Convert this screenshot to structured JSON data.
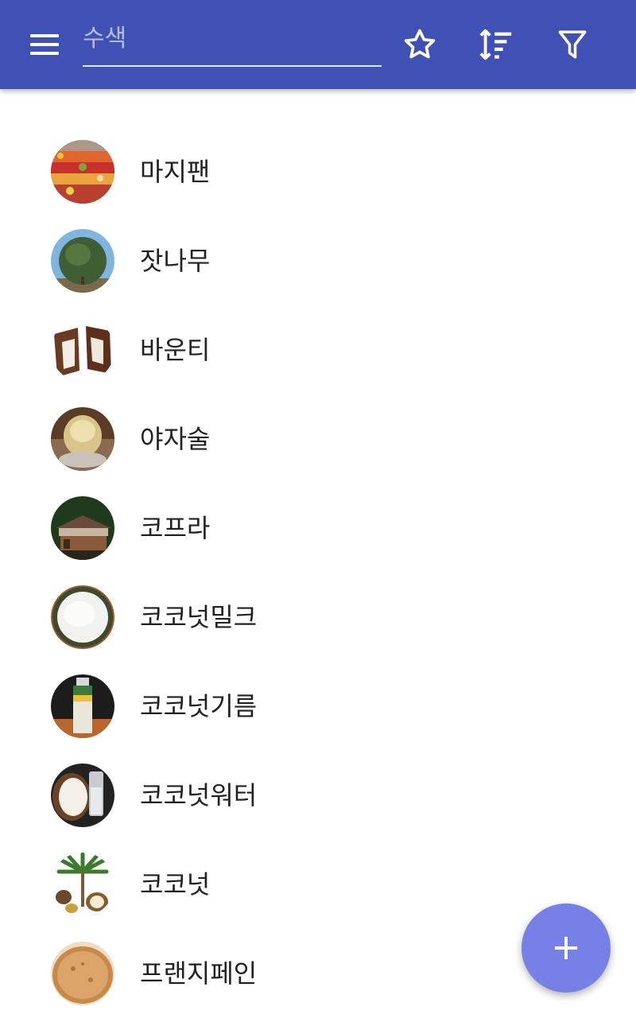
{
  "header": {
    "search_placeholder": "수색",
    "search_value": "",
    "icons": {
      "menu": "menu-icon",
      "favorite": "star-outline-icon",
      "sort": "sort-icon",
      "filter": "filter-icon"
    },
    "background_color": "#3f51b5"
  },
  "items": [
    {
      "label": "마지팬",
      "thumb": "fruit-market-photo"
    },
    {
      "label": "잣나무",
      "thumb": "pine-tree-photo"
    },
    {
      "label": "바운티",
      "thumb": "chocolate-bar-photo"
    },
    {
      "label": "야자술",
      "thumb": "glass-drink-photo"
    },
    {
      "label": "코프라",
      "thumb": "drying-house-photo"
    },
    {
      "label": "코코넛밀크",
      "thumb": "milk-bowl-photo"
    },
    {
      "label": "코코넛기름",
      "thumb": "oil-bottle-photo"
    },
    {
      "label": "코코넛워터",
      "thumb": "coconut-water-photo"
    },
    {
      "label": "코코넛",
      "thumb": "coconut-palm-illustration"
    },
    {
      "label": "프랜지페인",
      "thumb": "tart-photo"
    }
  ],
  "fab": {
    "icon": "plus-icon",
    "color": "#7581e6"
  }
}
